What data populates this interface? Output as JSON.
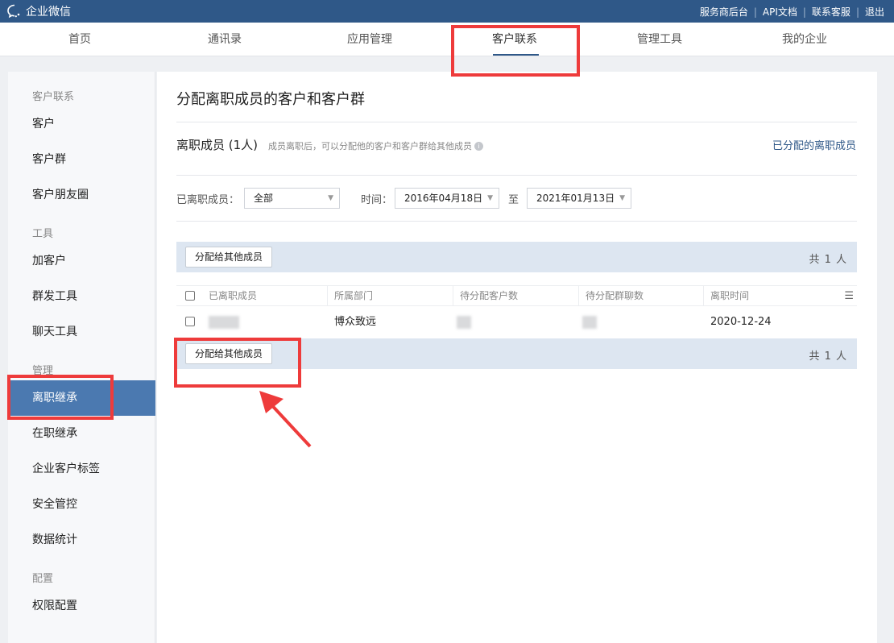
{
  "app": {
    "logo_text": "企业微信",
    "top_links": [
      "服务商后台",
      "API文档",
      "联系客服",
      "退出"
    ]
  },
  "nav": {
    "tabs": [
      {
        "label": "首页"
      },
      {
        "label": "通讯录"
      },
      {
        "label": "应用管理"
      },
      {
        "label": "客户联系",
        "active": true
      },
      {
        "label": "管理工具"
      },
      {
        "label": "我的企业"
      }
    ]
  },
  "sidebar": {
    "sections": [
      {
        "category": "客户联系",
        "items": [
          "客户",
          "客户群",
          "客户朋友圈"
        ]
      },
      {
        "category": "工具",
        "items": [
          "加客户",
          "群发工具",
          "聊天工具"
        ]
      },
      {
        "category": "管理",
        "items": [
          "离职继承",
          "在职继承",
          "企业客户标签",
          "安全管控",
          "数据统计"
        ]
      },
      {
        "category": "配置",
        "items": [
          "权限配置"
        ]
      }
    ],
    "active_item": "离职继承"
  },
  "main": {
    "title": "分配离职成员的客户和客户群",
    "section_title": "离职成员 (1人)",
    "section_desc": "成员离职后，可以分配他的客户和客户群给其他成员",
    "assigned_link": "已分配的离职成员",
    "filters": {
      "member_label": "已离职成员：",
      "member_value": "全部",
      "time_label": "时间：",
      "date_from": "2016年04月18日",
      "to_label": "至",
      "date_to": "2021年01月13日"
    },
    "assign_button": "分配给其他成员",
    "total_count": "共 1 人",
    "table": {
      "columns": [
        "已离职成员",
        "所属部门",
        "待分配客户数",
        "待分配群聊数",
        "离职时间"
      ],
      "rows": [
        {
          "member": "",
          "department": "博众致远",
          "pending_customers": "",
          "pending_groups": "",
          "leave_time": "2020-12-24"
        }
      ]
    }
  },
  "colors": {
    "topbar": "#2f5888",
    "active_sidebar": "#4b79b0",
    "annotation_red": "#ee3b3b",
    "toolbar_bg": "#dde6f1"
  }
}
